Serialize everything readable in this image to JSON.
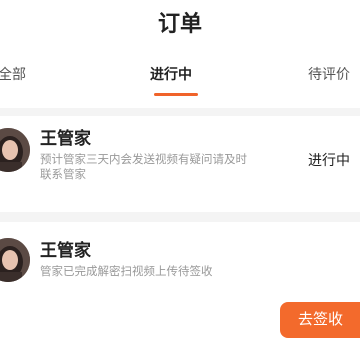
{
  "header": {
    "title": "订单"
  },
  "tabs": [
    {
      "label": "全部"
    },
    {
      "label": "进行中"
    },
    {
      "label": "待评价"
    }
  ],
  "orders": [
    {
      "name": "王管家",
      "description": "预计管家三天内会发送视频有疑问请及时联系管家",
      "status": "进行中"
    },
    {
      "name": "王管家",
      "description": "管家已完成解密扫视频上传待签收",
      "action_label": "去签收"
    }
  ],
  "colors": {
    "accent": "#f36a2c",
    "divider": "#f4f4f4"
  }
}
